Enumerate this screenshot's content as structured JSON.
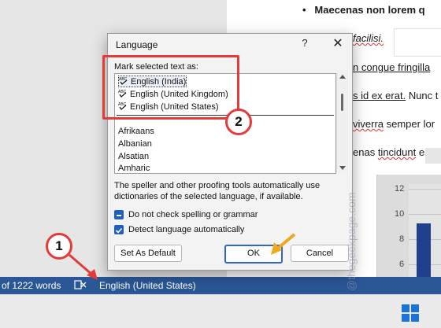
{
  "document": {
    "lines": [
      {
        "text": "Maecenas non lorem q",
        "bullet": true
      },
      {
        "text": "facilisi."
      },
      {
        "text": "n congue fringilla"
      },
      {
        "text": "s id ex erat.",
        "tail": " Nunc t"
      },
      {
        "text": "viverra",
        "tail": " semper lor"
      },
      {
        "text": "enas ",
        "mid": "tincidunt",
        "tail": " est d"
      }
    ],
    "chart_ticks": [
      "12",
      "10",
      "8",
      "6"
    ]
  },
  "dialog": {
    "title": "Language",
    "help_label": "?",
    "close_label": "✕",
    "mark_label": "Mark selected text as:",
    "selected_languages": [
      "English (India)",
      "English (United Kingdom)",
      "English (United States)"
    ],
    "other_languages": [
      "Afrikaans",
      "Albanian",
      "Alsatian",
      "Amharic"
    ],
    "info_text": "The speller and other proofing tools automatically use dictionaries of the selected language, if available.",
    "checkbox_no_check": {
      "label": "Do not check spelling or grammar",
      "checked": true
    },
    "checkbox_detect": {
      "label": "Detect language automatically",
      "checked": true
    },
    "set_default_label": "Set As Default",
    "ok_label": "OK",
    "cancel_label": "Cancel"
  },
  "statusbar": {
    "word_count": "of 1222 words",
    "language": "English (United States)"
  },
  "annotations": {
    "step1": "1",
    "step2": "2",
    "watermark": "@thegeekpage.com"
  },
  "colors": {
    "accent": "#1f5fbf",
    "statusbar": "#2b5797",
    "highlight": "#e33a3a",
    "arrow": "#f0a81c"
  }
}
